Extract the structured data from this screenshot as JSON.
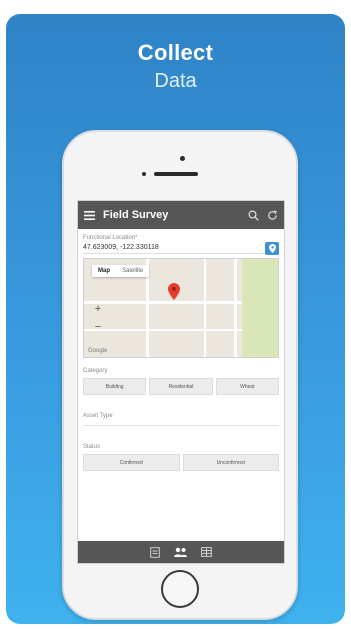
{
  "headline": {
    "line1": "Collect",
    "line2": "Data"
  },
  "app": {
    "title": "Field Survey",
    "icons": {
      "menu": "hamburger-menu-icon",
      "search": "search-icon",
      "refresh": "refresh-icon"
    }
  },
  "location": {
    "label": "Functional Location*",
    "value": "47.623009, -122.330118"
  },
  "map": {
    "tabs": [
      "Map",
      "Satellite"
    ],
    "zoom_in": "+",
    "zoom_out": "−",
    "google": "Google"
  },
  "category": {
    "label": "Category",
    "options": [
      "Building",
      "Residential",
      "Wheat"
    ]
  },
  "asset_type": {
    "label": "Asset Type"
  },
  "status": {
    "label": "Status",
    "options": [
      "Confirmed",
      "Unconfirmed"
    ]
  },
  "bottom_nav": {
    "icons": [
      "form-icon",
      "users-icon",
      "table-icon"
    ]
  },
  "colors": {
    "card_top": "#2f83c6",
    "card_bottom": "#3fb2ee",
    "appbar": "#565656",
    "pin": "#e63b2e",
    "accent": "#3e8fd3"
  }
}
